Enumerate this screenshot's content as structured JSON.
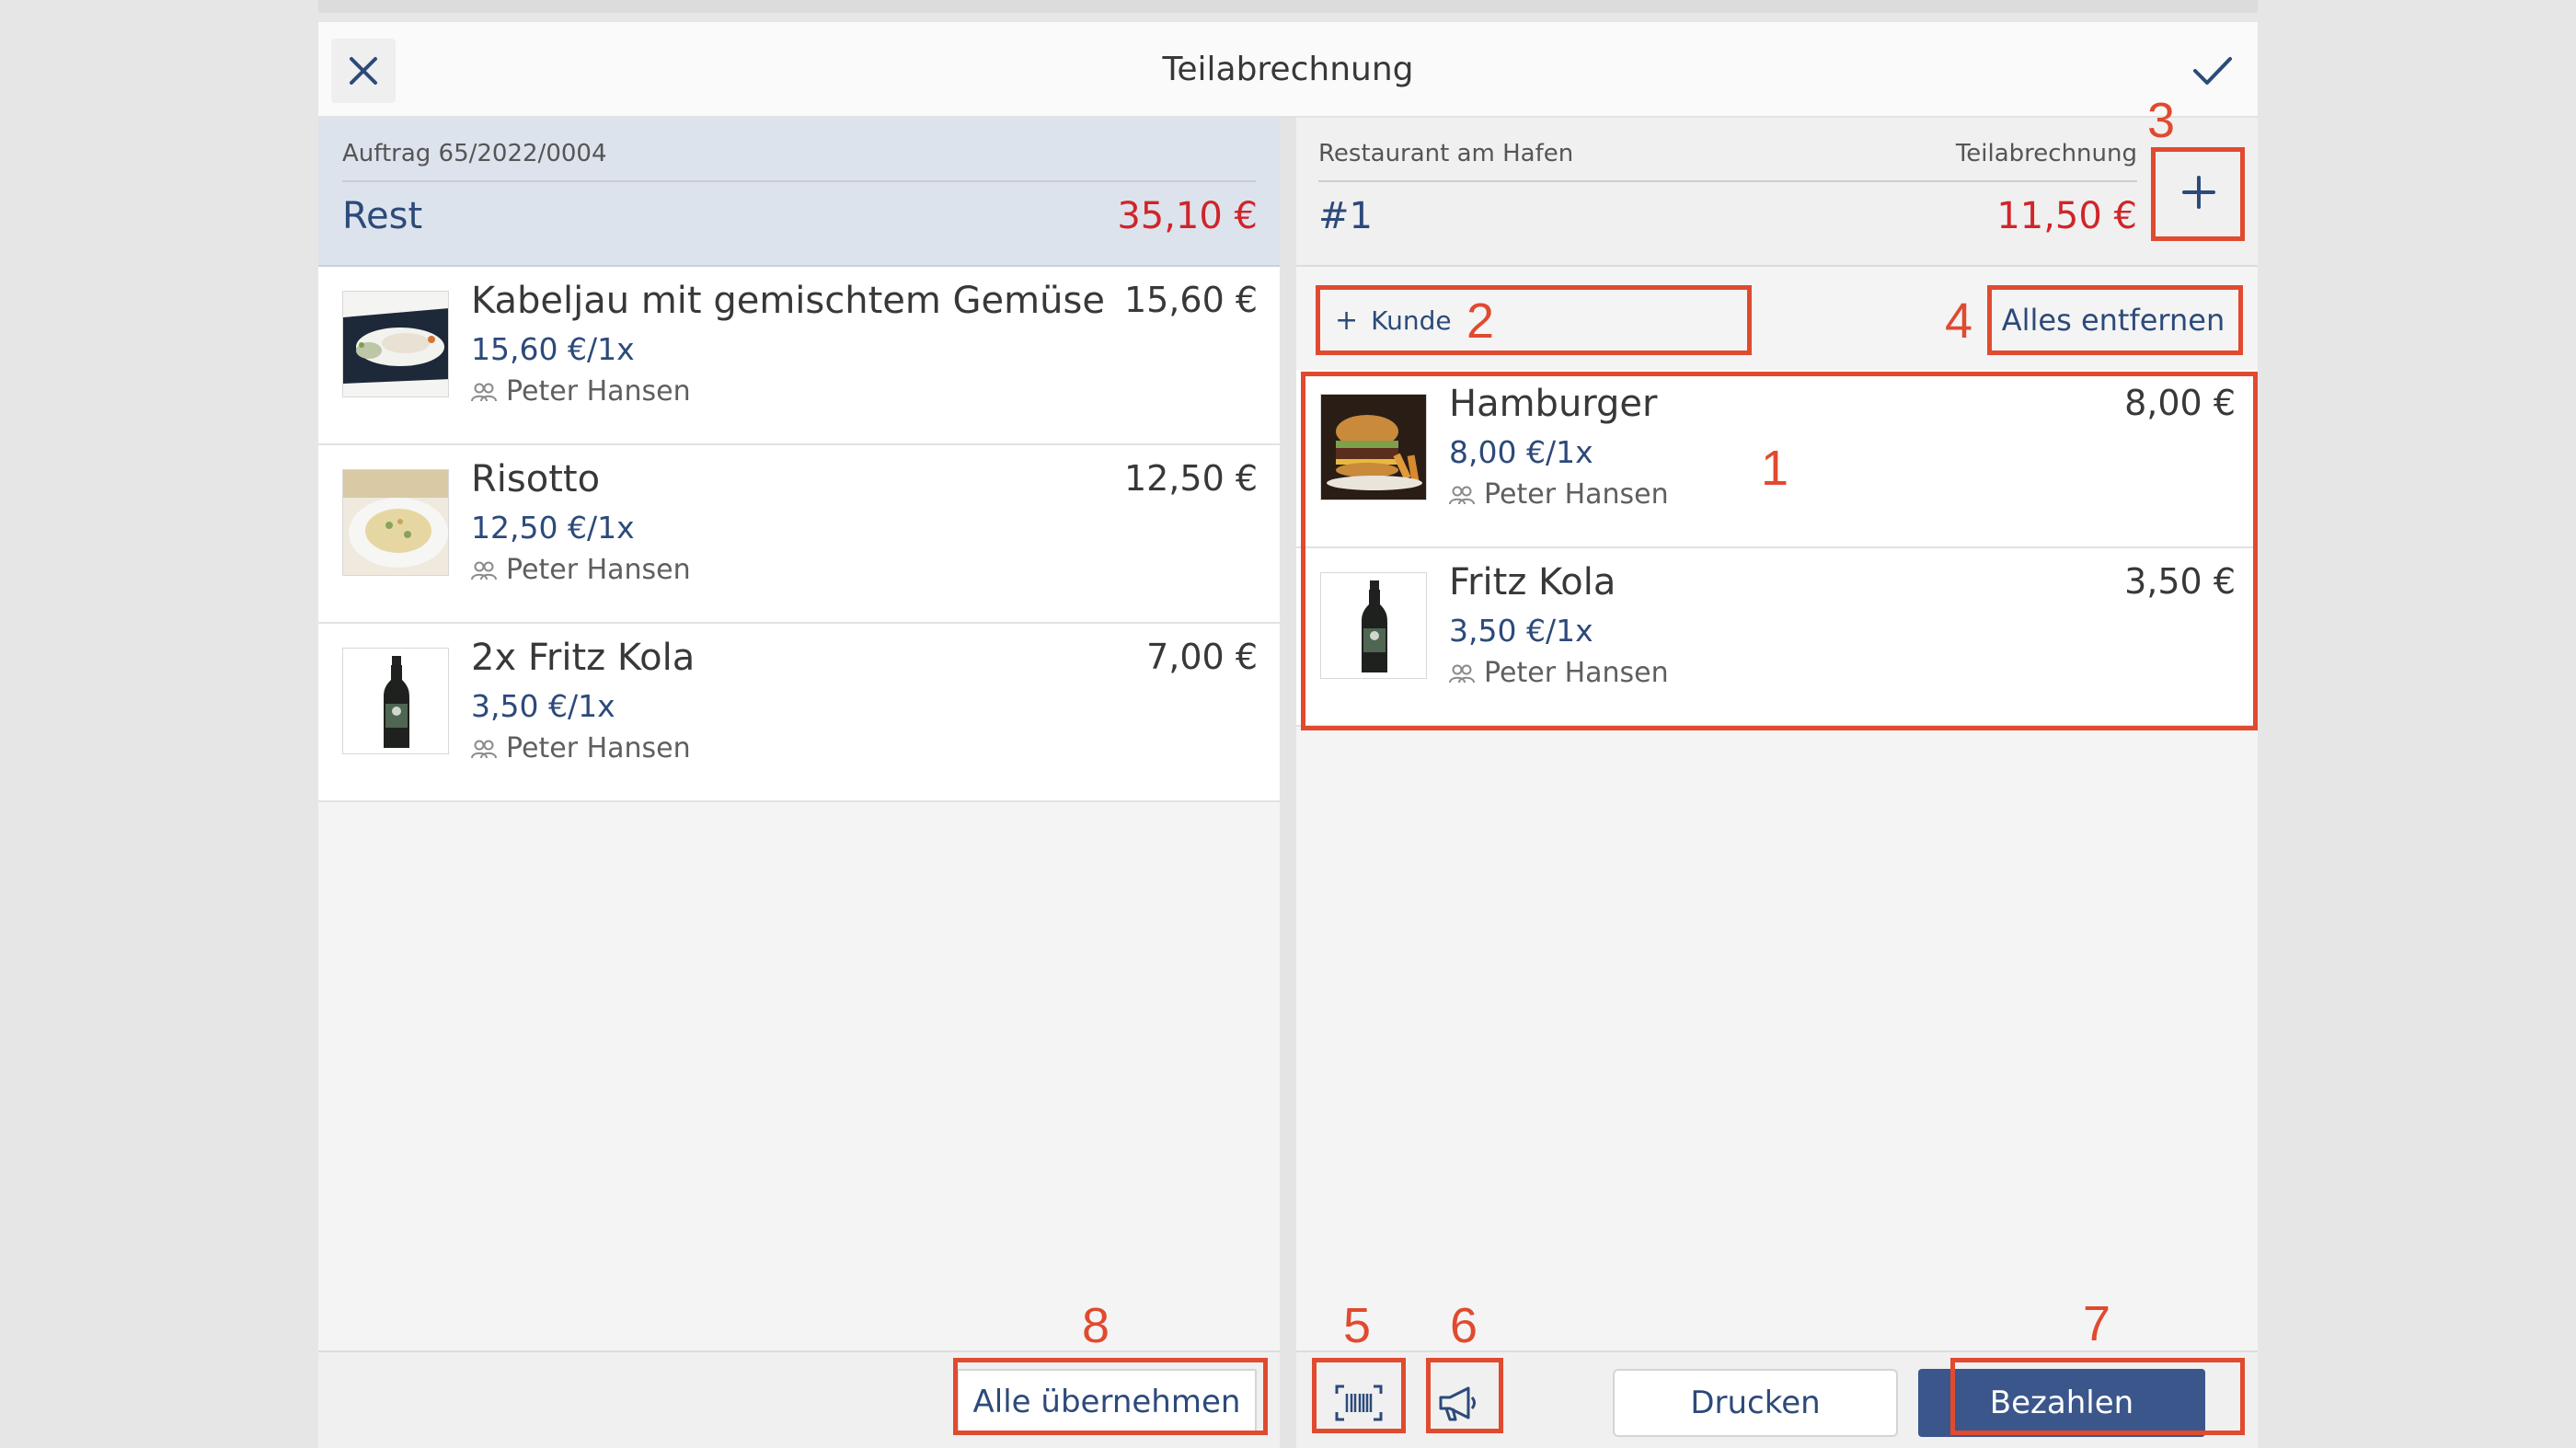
{
  "dialog": {
    "title": "Teilabrechnung"
  },
  "left": {
    "order_label": "Auftrag 65/2022/0004",
    "remainder_label": "Rest",
    "remainder_amount": "35,10 €",
    "items": [
      {
        "name": "Kabeljau mit gemischtem Gemüse",
        "unit": "15,60 €/1x",
        "guest": "Peter Hansen",
        "price": "15,60 €",
        "image": "fish-dish"
      },
      {
        "name": "Risotto",
        "unit": "12,50 €/1x",
        "guest": "Peter Hansen",
        "price": "12,50 €",
        "image": "risotto-dish"
      },
      {
        "name": "2x Fritz Kola",
        "unit": "3,50 €/1x",
        "guest": "Peter Hansen",
        "price": "7,00 €",
        "image": "cola-bottle"
      }
    ],
    "take_all_label": "Alle übernehmen"
  },
  "right": {
    "restaurant_label": "Restaurant am Hafen",
    "bill_type_label": "Teilabrechnung",
    "bill_number": "#1",
    "bill_amount": "11,50 €",
    "add_customer_label": "Kunde",
    "remove_all_label": "Alles entfernen",
    "items": [
      {
        "name": "Hamburger",
        "unit": "8,00 €/1x",
        "guest": "Peter Hansen",
        "price": "8,00 €",
        "image": "burger"
      },
      {
        "name": "Fritz Kola",
        "unit": "3,50 €/1x",
        "guest": "Peter Hansen",
        "price": "3,50 €",
        "image": "cola-bottle"
      }
    ],
    "print_label": "Drucken",
    "pay_label": "Bezahlen"
  },
  "annotations": [
    "1",
    "2",
    "3",
    "4",
    "5",
    "6",
    "7",
    "8"
  ],
  "colors": {
    "accent": "#2c4a7a",
    "primary_button": "#3b568b",
    "amount_red": "#d0252a",
    "annotation": "#e04a2f"
  }
}
